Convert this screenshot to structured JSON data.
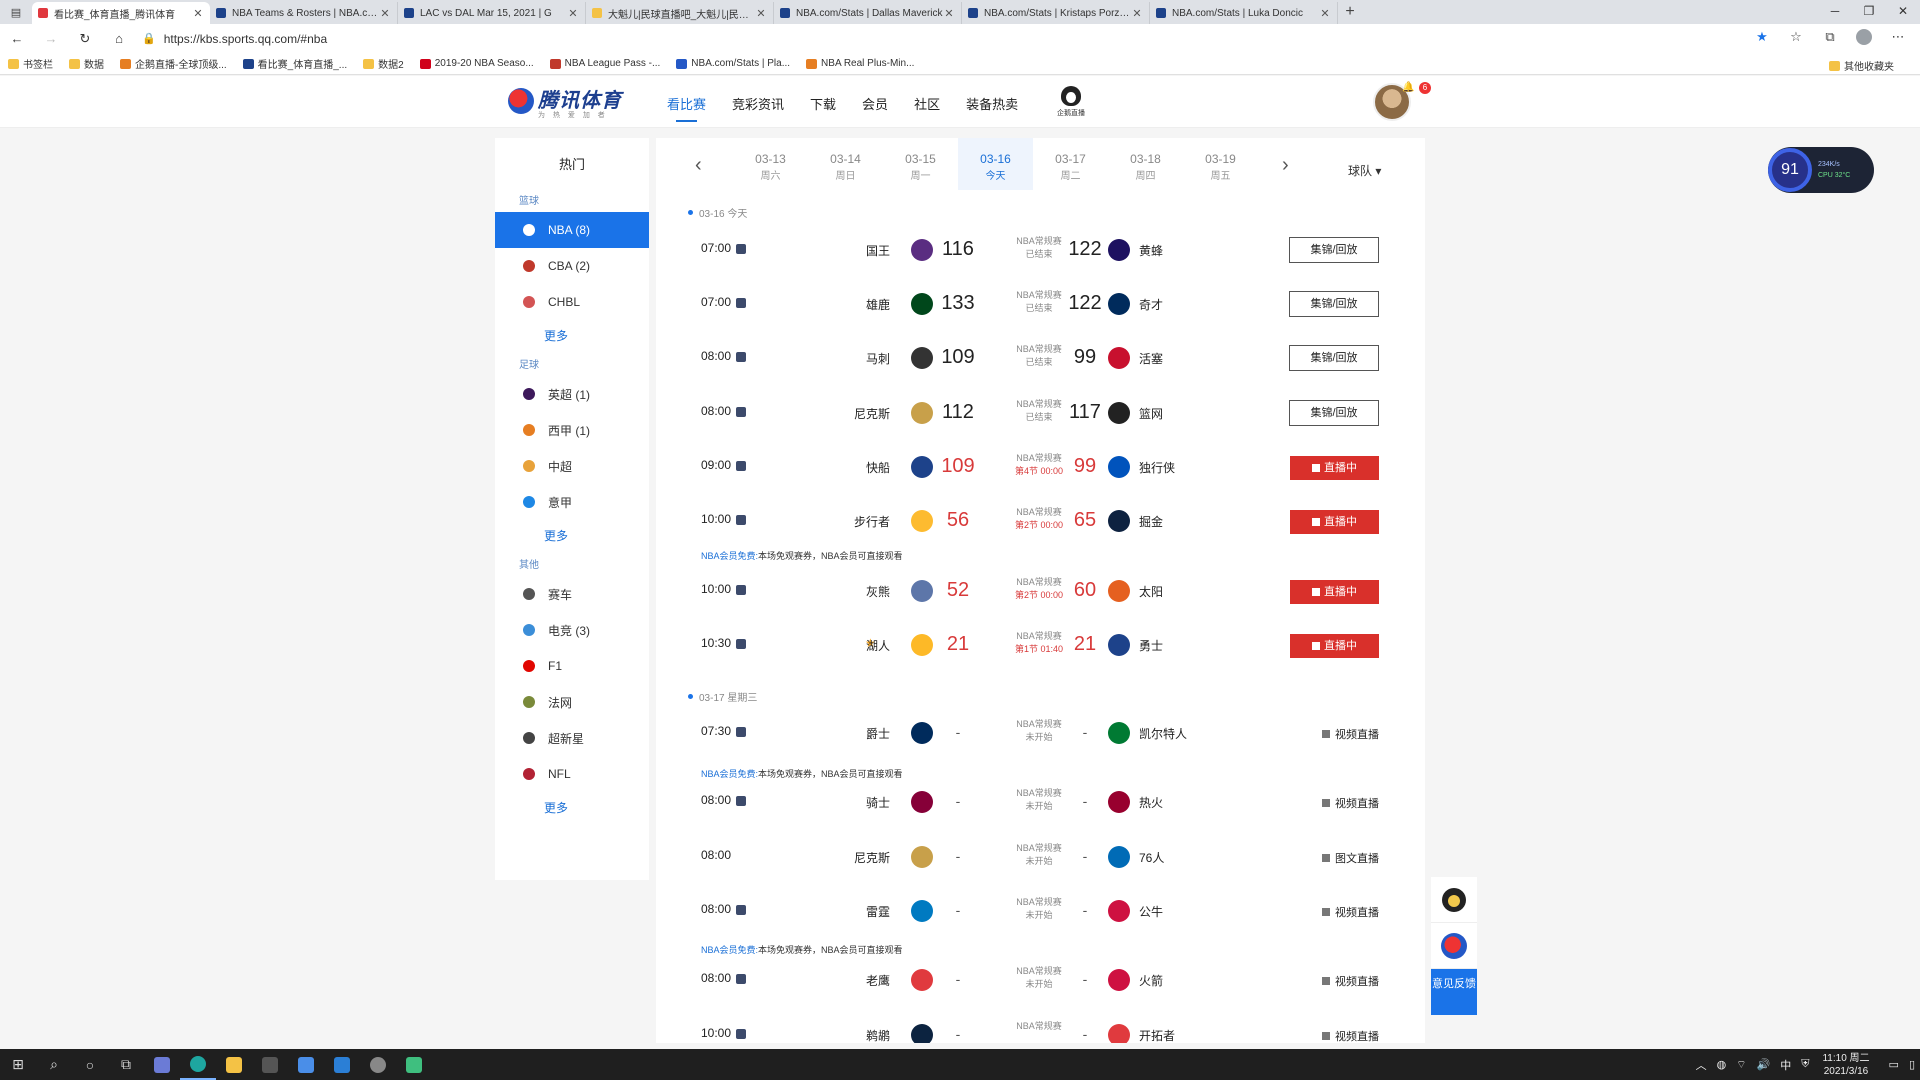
{
  "browser": {
    "tabs": [
      {
        "title": "看比赛_体育直播_腾讯体育",
        "color": "#e0383e"
      },
      {
        "title": "NBA Teams & Rosters | NBA.com",
        "color": "#1d428a"
      },
      {
        "title": "LAC vs DAL Mar 15, 2021 | G",
        "color": "#1d428a"
      },
      {
        "title": "大魁儿|民球直播吧_大魁儿|民球N",
        "color": "#f4c245"
      },
      {
        "title": "NBA.com/Stats | Dallas Maverick",
        "color": "#1d428a"
      },
      {
        "title": "NBA.com/Stats | Kristaps Porzing",
        "color": "#1d428a"
      },
      {
        "title": "NBA.com/Stats | Luka Doncic",
        "color": "#1d428a"
      }
    ],
    "url": "https://kbs.sports.qq.com/#nba",
    "bookmarks": [
      "书签栏",
      "数据",
      "企鹅直播-全球顶级...",
      "看比赛_体育直播_...",
      "数据2",
      "2019-20 NBA Seaso...",
      "NBA League Pass -...",
      "NBA.com/Stats | Pla...",
      "NBA Real Plus-Min..."
    ],
    "other_bookmarks": "其他收藏夹"
  },
  "header": {
    "logo_name": "腾讯体育",
    "logo_slogan": "为 热 爱 加 者",
    "nav": [
      "看比赛",
      "竞彩资讯",
      "下载",
      "会员",
      "社区",
      "装备热卖"
    ],
    "live_label": "企鹅直播",
    "notif_count": "6"
  },
  "sidebar": {
    "hot": "热门",
    "groups": [
      {
        "name": "篮球",
        "items": [
          {
            "label": "NBA (8)",
            "color": "#e0383e"
          },
          {
            "label": "CBA (2)",
            "color": "#c0392b"
          },
          {
            "label": "CHBL",
            "color": "#d35454"
          }
        ],
        "more": "更多"
      },
      {
        "name": "足球",
        "items": [
          {
            "label": "英超 (1)",
            "color": "#3d195b"
          },
          {
            "label": "西甲 (1)",
            "color": "#e67e22"
          },
          {
            "label": "中超",
            "color": "#e8a23a"
          },
          {
            "label": "意甲",
            "color": "#1e88e5"
          }
        ],
        "more": "更多"
      },
      {
        "name": "其他",
        "items": [
          {
            "label": "赛车",
            "color": "#555555"
          },
          {
            "label": "电竞 (3)",
            "color": "#3b8ed8"
          },
          {
            "label": "F1",
            "color": "#e10600"
          },
          {
            "label": "法网",
            "color": "#7a8a3a"
          },
          {
            "label": "超新星",
            "color": "#444444"
          },
          {
            "label": "NFL",
            "color": "#b22234"
          }
        ],
        "more": "更多"
      }
    ]
  },
  "dates": [
    {
      "d": "03-13",
      "w": "周六"
    },
    {
      "d": "03-14",
      "w": "周日"
    },
    {
      "d": "03-15",
      "w": "周一"
    },
    {
      "d": "03-16",
      "w": "今天"
    },
    {
      "d": "03-17",
      "w": "周二"
    },
    {
      "d": "03-18",
      "w": "周四"
    },
    {
      "d": "03-19",
      "w": "周五"
    }
  ],
  "team_filter": "球队",
  "day1_label": "03-16 今天",
  "day2_label": "03-17 星期三",
  "member_note_tag": "NBA会员免费:",
  "member_note_text": "本场免观赛券，NBA会员可直接观看",
  "games": [
    {
      "time": "07:00",
      "home": "国王",
      "hs": "116",
      "league": "NBA常规赛",
      "status": "已结束",
      "as": "122",
      "away": "黄蜂",
      "action": "集锦/回放",
      "hc": "#5a2d81",
      "ac": "#1d1160"
    },
    {
      "time": "07:00",
      "home": "雄鹿",
      "hs": "133",
      "league": "NBA常规赛",
      "status": "已结束",
      "as": "122",
      "away": "奇才",
      "action": "集锦/回放",
      "hc": "#00471b",
      "ac": "#002b5c"
    },
    {
      "time": "08:00",
      "home": "马刺",
      "hs": "109",
      "league": "NBA常规赛",
      "status": "已结束",
      "as": "99",
      "away": "活塞",
      "action": "集锦/回放",
      "hc": "#333333",
      "ac": "#c8102e"
    },
    {
      "time": "08:00",
      "home": "尼克斯",
      "hs": "112",
      "league": "NBA常规赛",
      "status": "已结束",
      "as": "117",
      "away": "篮网",
      "action": "集锦/回放",
      "hc": "#c8a04a",
      "ac": "#222222"
    },
    {
      "time": "09:00",
      "home": "快船",
      "hs": "109",
      "league": "NBA常规赛",
      "status": "第4节 00:00",
      "as": "99",
      "away": "独行侠",
      "action": "直播中",
      "hc": "#1d428a",
      "ac": "#0053bc"
    },
    {
      "time": "10:00",
      "home": "步行者",
      "hs": "56",
      "league": "NBA常规赛",
      "status": "第2节 00:00",
      "as": "65",
      "away": "掘金",
      "action": "直播中",
      "hc": "#fdbb30",
      "ac": "#0e2240"
    },
    {
      "time": "10:00",
      "home": "灰熊",
      "hs": "52",
      "league": "NBA常规赛",
      "status": "第2节 00:00",
      "as": "60",
      "away": "太阳",
      "action": "直播中",
      "hc": "#5d76a9",
      "ac": "#e56020"
    },
    {
      "time": "10:30",
      "home": "湖人",
      "hs": "21",
      "league": "NBA常规赛",
      "status": "第1节 01:40",
      "as": "21",
      "away": "勇士",
      "action": "直播中",
      "hc": "#fdb927",
      "ac": "#1d428a"
    },
    {
      "time": "07:30",
      "home": "爵士",
      "hs": "-",
      "league": "NBA常规赛",
      "status": "未开始",
      "as": "-",
      "away": "凯尔特人",
      "action": "视频直播",
      "hc": "#002b5c",
      "ac": "#007a33"
    },
    {
      "time": "08:00",
      "home": "骑士",
      "hs": "-",
      "league": "NBA常规赛",
      "status": "未开始",
      "as": "-",
      "away": "热火",
      "action": "视频直播",
      "hc": "#860038",
      "ac": "#98002e"
    },
    {
      "time": "08:00",
      "home": "尼克斯",
      "hs": "-",
      "league": "NBA常规赛",
      "status": "未开始",
      "as": "-",
      "away": "76人",
      "action": "图文直播",
      "hc": "#c8a04a",
      "ac": "#006bb6"
    },
    {
      "time": "08:00",
      "home": "雷霆",
      "hs": "-",
      "league": "NBA常规赛",
      "status": "未开始",
      "as": "-",
      "away": "公牛",
      "action": "视频直播",
      "hc": "#007ac1",
      "ac": "#ce1141"
    },
    {
      "time": "08:00",
      "home": "老鹰",
      "hs": "-",
      "league": "NBA常规赛",
      "status": "未开始",
      "as": "-",
      "away": "火箭",
      "action": "视频直播",
      "hc": "#e03a3e",
      "ac": "#ce1141"
    },
    {
      "time": "10:00",
      "home": "鹈鹕",
      "hs": "-",
      "league": "NBA常规赛",
      "status": "",
      "as": "-",
      "away": "开拓者",
      "action": "视频直播",
      "hc": "#0c2340",
      "ac": "#e03a3e"
    }
  ],
  "widget": {
    "value": "91",
    "net": "234K/s",
    "cpu": "CPU 32°C"
  },
  "side_tools": {
    "feedback": "意见反馈"
  },
  "taskbar": {
    "time": "11:10 周二",
    "date": "2021/3/16",
    "ime": "中"
  }
}
